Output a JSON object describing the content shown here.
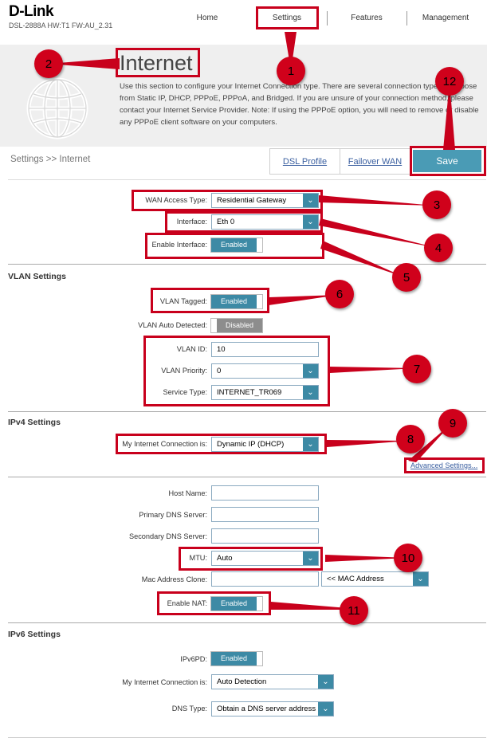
{
  "brand": {
    "logo": "D-Link",
    "model": "DSL-2888A   HW:T1   FW:AU_2.31"
  },
  "nav": {
    "home": "Home",
    "settings": "Settings",
    "features": "Features",
    "management": "Management"
  },
  "hero": {
    "title": "Internet",
    "description": "Use this section to configure your Internet Connection type. There are several connection types to choose from Static IP, DHCP, PPPoE, PPPoA, and Bridged. If you are unsure of your connection method, please contact your Internet Service Provider. Note: If using the PPPoE option, you will need to remove or disable any PPPoE client software on your computers."
  },
  "breadcrumb": "Settings >> Internet",
  "tabs": {
    "dsl_profile": "DSL Profile",
    "failover_wan": "Failover WAN",
    "save": "Save"
  },
  "wan": {
    "access_type_label": "WAN Access Type:",
    "access_type_value": "Residential Gateway",
    "interface_label": "Interface:",
    "interface_value": "Eth 0",
    "enable_label": "Enable Interface:",
    "enable_value": "Enabled"
  },
  "vlan": {
    "section": "VLAN Settings",
    "tagged_label": "VLAN Tagged:",
    "tagged_value": "Enabled",
    "auto_label": "VLAN Auto Detected:",
    "auto_value": "Disabled",
    "id_label": "VLAN ID:",
    "id_value": "10",
    "priority_label": "VLAN Priority:",
    "priority_value": "0",
    "service_label": "Service Type:",
    "service_value": "INTERNET_TR069"
  },
  "ipv4": {
    "section": "IPv4 Settings",
    "conn_label": "My Internet Connection is:",
    "conn_value": "Dynamic IP (DHCP)",
    "advanced": "Advanced Settings...",
    "host_label": "Host Name:",
    "pdns_label": "Primary DNS Server:",
    "sdns_label": "Secondary DNS Server:",
    "mtu_label": "MTU:",
    "mtu_value": "Auto",
    "mac_label": "Mac Address Clone:",
    "mac_select": "<< MAC Address",
    "nat_label": "Enable NAT:",
    "nat_value": "Enabled"
  },
  "ipv6": {
    "section": "IPv6 Settings",
    "pd_label": "IPv6PD:",
    "pd_value": "Enabled",
    "conn_label": "My Internet Connection is:",
    "conn_value": "Auto Detection",
    "dns_label": "DNS Type:",
    "dns_value": "Obtain a DNS server address"
  },
  "markers": [
    "1",
    "2",
    "3",
    "4",
    "5",
    "6",
    "7",
    "8",
    "9",
    "10",
    "11",
    "12"
  ],
  "colors": {
    "accent": "#3d8aa5",
    "annotation": "#d0011b"
  }
}
